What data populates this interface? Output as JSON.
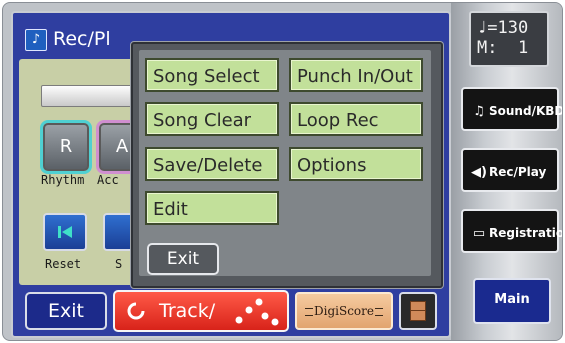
{
  "screen": {
    "title": "Rec/Pl",
    "parts": [
      {
        "letter": "R",
        "label": "Rhythm"
      },
      {
        "letter": "A",
        "label": "Acc"
      }
    ],
    "transport_labels": [
      "Reset",
      "S"
    ]
  },
  "popup": {
    "items": [
      {
        "label": "Song Select"
      },
      {
        "label": "Punch In/Out"
      },
      {
        "label": "Song Clear"
      },
      {
        "label": "Loop Rec"
      },
      {
        "label": "Save/Delete"
      },
      {
        "label": "Options"
      },
      {
        "label": "Edit"
      }
    ],
    "exit_label": "Exit"
  },
  "bottom": {
    "exit_label": "Exit",
    "track_label": "Track/",
    "digiscore_label": "DigiScore"
  },
  "right_panel": {
    "tempo_line": "♩=130",
    "measure_line": "M:  1",
    "buttons": [
      {
        "label": "Sound/KBD",
        "icon": "music-note-icon",
        "glyph": "♫"
      },
      {
        "label": "Rec/Play",
        "icon": "speaker-icon",
        "glyph": "◀)"
      },
      {
        "label": "Registration",
        "icon": "book-icon",
        "glyph": "▭"
      }
    ],
    "main_label": "Main"
  },
  "colors": {
    "screen_bg": "#2f3ea0",
    "menu_item": "#c2e09a",
    "track_button": "#e33a2b",
    "digiscore_button": "#eab383",
    "side_button": "#141414",
    "main_button": "#1a2a8f"
  }
}
